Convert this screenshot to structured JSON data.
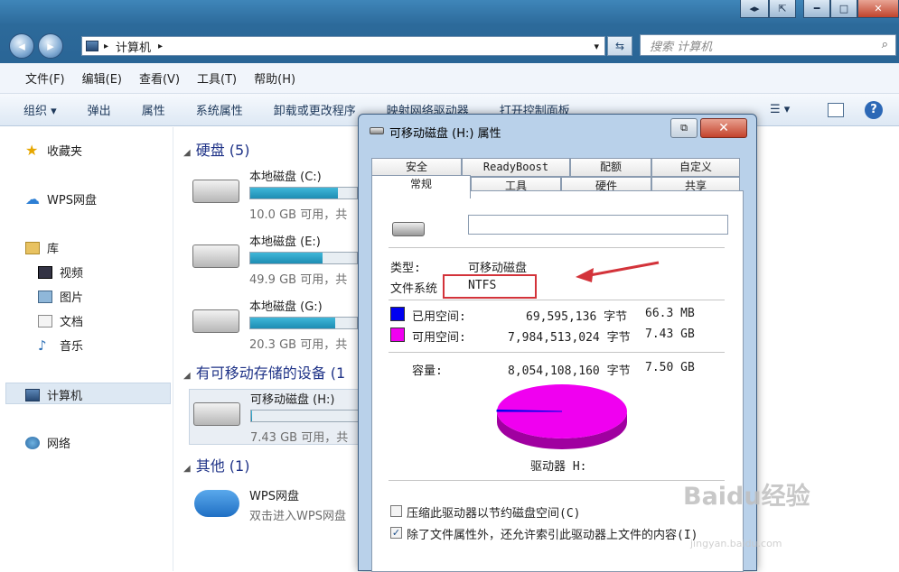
{
  "window": {
    "winbtn_nav": "◂▸",
    "winbtn_restore": "⇱",
    "winbtn_min": "━",
    "winbtn_max": "□",
    "winbtn_close": "✕"
  },
  "address": {
    "path_sep": "▸",
    "path": "计算机",
    "path_end": "▸",
    "dropdown": "▾",
    "refresh": "⇆"
  },
  "search": {
    "placeholder": "搜索 计算机",
    "icon": "⌕"
  },
  "menubar": [
    "文件(F)",
    "编辑(E)",
    "查看(V)",
    "工具(T)",
    "帮助(H)"
  ],
  "cmdbar": [
    "组织 ▾",
    "弹出",
    "属性",
    "系统属性",
    "卸载或更改程序",
    "映射网络驱动器",
    "打开控制面板"
  ],
  "left_nav": {
    "favorites": "收藏夹",
    "wps": "WPS网盘",
    "libraries": "库",
    "videos": "视频",
    "pictures": "图片",
    "documents": "文档",
    "music": "音乐",
    "computer": "计算机",
    "network": "网络"
  },
  "content": {
    "group_hdd": "硬盘 (5)",
    "group_removable": "有可移动存储的设备 (1",
    "group_other": "其他 (1)",
    "drives": [
      {
        "name": "本地磁盘 (C:)",
        "info": "10.0 GB 可用，共",
        "fill": 0.82
      },
      {
        "name": "本地磁盘 (E:)",
        "info": "49.9 GB 可用，共",
        "fill": 0.68
      },
      {
        "name": "本地磁盘 (G:)",
        "info": "20.3 GB 可用，共",
        "fill": 0.8
      }
    ],
    "removable": {
      "name": "可移动磁盘 (H:)",
      "info": "7.43 GB 可用，共",
      "fill": 0.01
    },
    "other": {
      "name": "WPS网盘",
      "sub": "双击进入WPS网盘"
    }
  },
  "dialog": {
    "title": "可移动磁盘 (H:) 属性",
    "help": "⧉",
    "close": "✕",
    "tabs_row1": [
      "安全",
      "ReadyBoost",
      "配额",
      "自定义"
    ],
    "tabs_row2": [
      "常规",
      "工具",
      "硬件",
      "共享"
    ],
    "name_value": "",
    "type_label": "类型:",
    "type_value": "可移动磁盘",
    "fs_label": "文件系统",
    "fs_value": "NTFS",
    "used_label": "已用空间:",
    "used_bytes": "69,595,136 字节",
    "used_size": "66.3 MB",
    "free_label": "可用空间:",
    "free_bytes": "7,984,513,024 字节",
    "free_size": "7.43 GB",
    "cap_label": "容量:",
    "cap_bytes": "8,054,108,160 字节",
    "cap_size": "7.50 GB",
    "drive_label": "驱动器 H:",
    "compress_label": "压缩此驱动器以节约磁盘空间(C)",
    "compress_checked": "",
    "index_label": "除了文件属性外，还允许索引此驱动器上文件的内容(I)",
    "index_checked": "✓",
    "used_fraction": 0.0086,
    "colors": {
      "used": "#0000f0",
      "free": "#f000f0"
    }
  },
  "watermark": {
    "text": "Baidu经验",
    "sub": "jingyan.baidu.com"
  }
}
